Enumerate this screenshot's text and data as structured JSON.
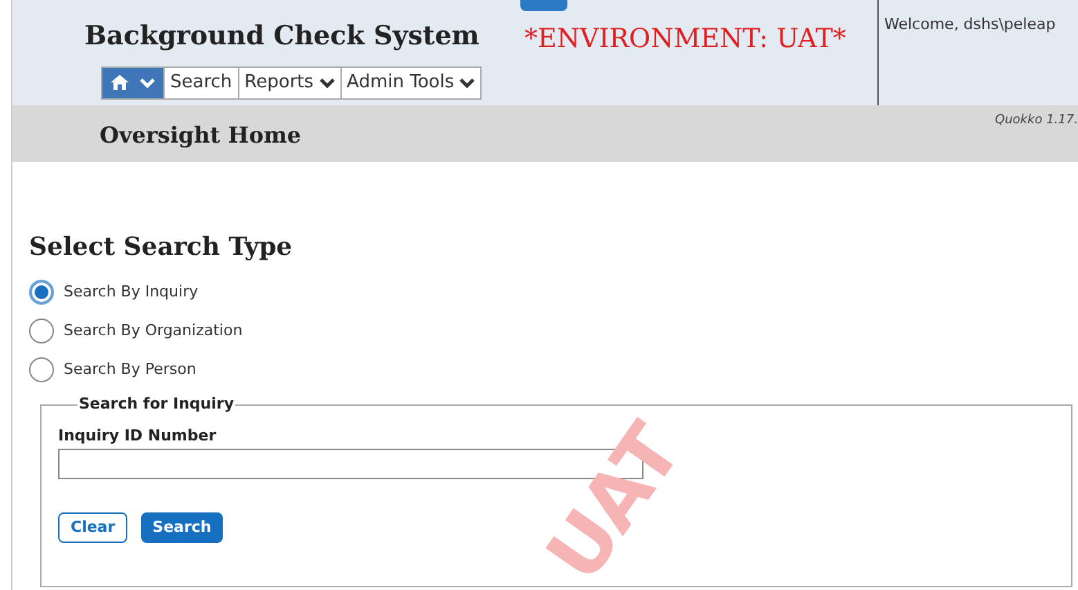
{
  "header": {
    "title": "Background Check System",
    "environment": "*ENVIRONMENT: UAT*",
    "welcome": "Welcome, dshs\\peleap"
  },
  "nav": [
    {
      "kind": "home"
    },
    {
      "kind": "link",
      "label": "Search"
    },
    {
      "kind": "menu",
      "label": "Reports"
    },
    {
      "kind": "menu",
      "label": "Admin Tools"
    }
  ],
  "page_bar": {
    "title": "Oversight Home",
    "version": "Quokko 1.17."
  },
  "search_type": {
    "heading": "Select Search Type",
    "options": [
      {
        "label": "Search By Inquiry",
        "selected": true
      },
      {
        "label": "Search By Organization",
        "selected": false
      },
      {
        "label": "Search By Person",
        "selected": false
      }
    ]
  },
  "form": {
    "legend": "Search for Inquiry",
    "field_label": "Inquiry ID Number",
    "buttons": [
      {
        "kind": "secondary",
        "label": "Clear"
      },
      {
        "kind": "primary",
        "label": "Search"
      }
    ]
  },
  "environment_stamp": "UAT"
}
